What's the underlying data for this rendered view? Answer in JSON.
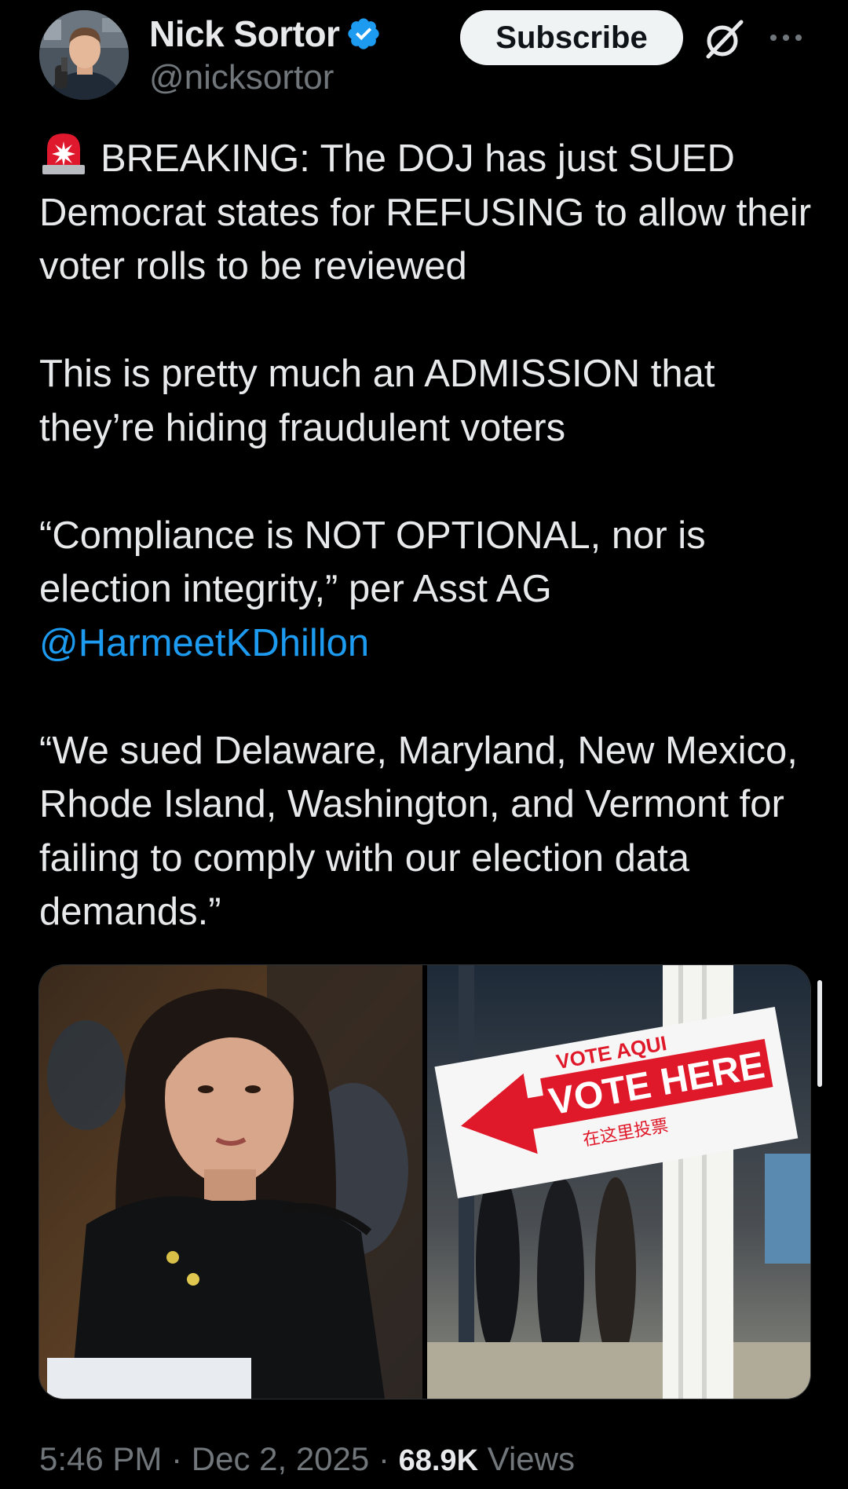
{
  "author": {
    "display_name": "Nick Sortor",
    "handle": "@nicksortor",
    "verified": true,
    "avatar": "avatar-photo"
  },
  "actions": {
    "subscribe_label": "Subscribe",
    "grok_icon": "grok-icon",
    "more_icon": "more-icon"
  },
  "tweet": {
    "alert_icon": "police-light-icon",
    "line1": "BREAKING: The DOJ has just SUED Democrat states for REFUSING to allow their voter rolls to be reviewed",
    "line2": "This is pretty much an ADMISSION that they’re hiding fraudulent voters",
    "line3": "“Compliance is NOT OPTIONAL, nor is election integrity,” per Asst AG",
    "mention": "@HarmeetKDhillon",
    "line4": "“We sued Delaware, Maryland, New Mexico, Rhode Island, Washington, and Vermont for failing to comply with our election data demands.”"
  },
  "media": {
    "photos": [
      {
        "name": "hearing-photo"
      },
      {
        "name": "vote-sign-photo",
        "sign_top": "VOTE AQUI",
        "sign_main": "VOTE HERE",
        "sign_chinese": "在这里投票"
      }
    ]
  },
  "meta": {
    "time": "5:46 PM",
    "date": "Dec 2, 2025",
    "views_count": "68.9K",
    "views_label": "Views",
    "separator": "·"
  },
  "colors": {
    "background": "#000000",
    "text": "#e7e9ea",
    "secondary_text": "#71767b",
    "link": "#1d9bf0",
    "verified": "#1d9bf0"
  }
}
